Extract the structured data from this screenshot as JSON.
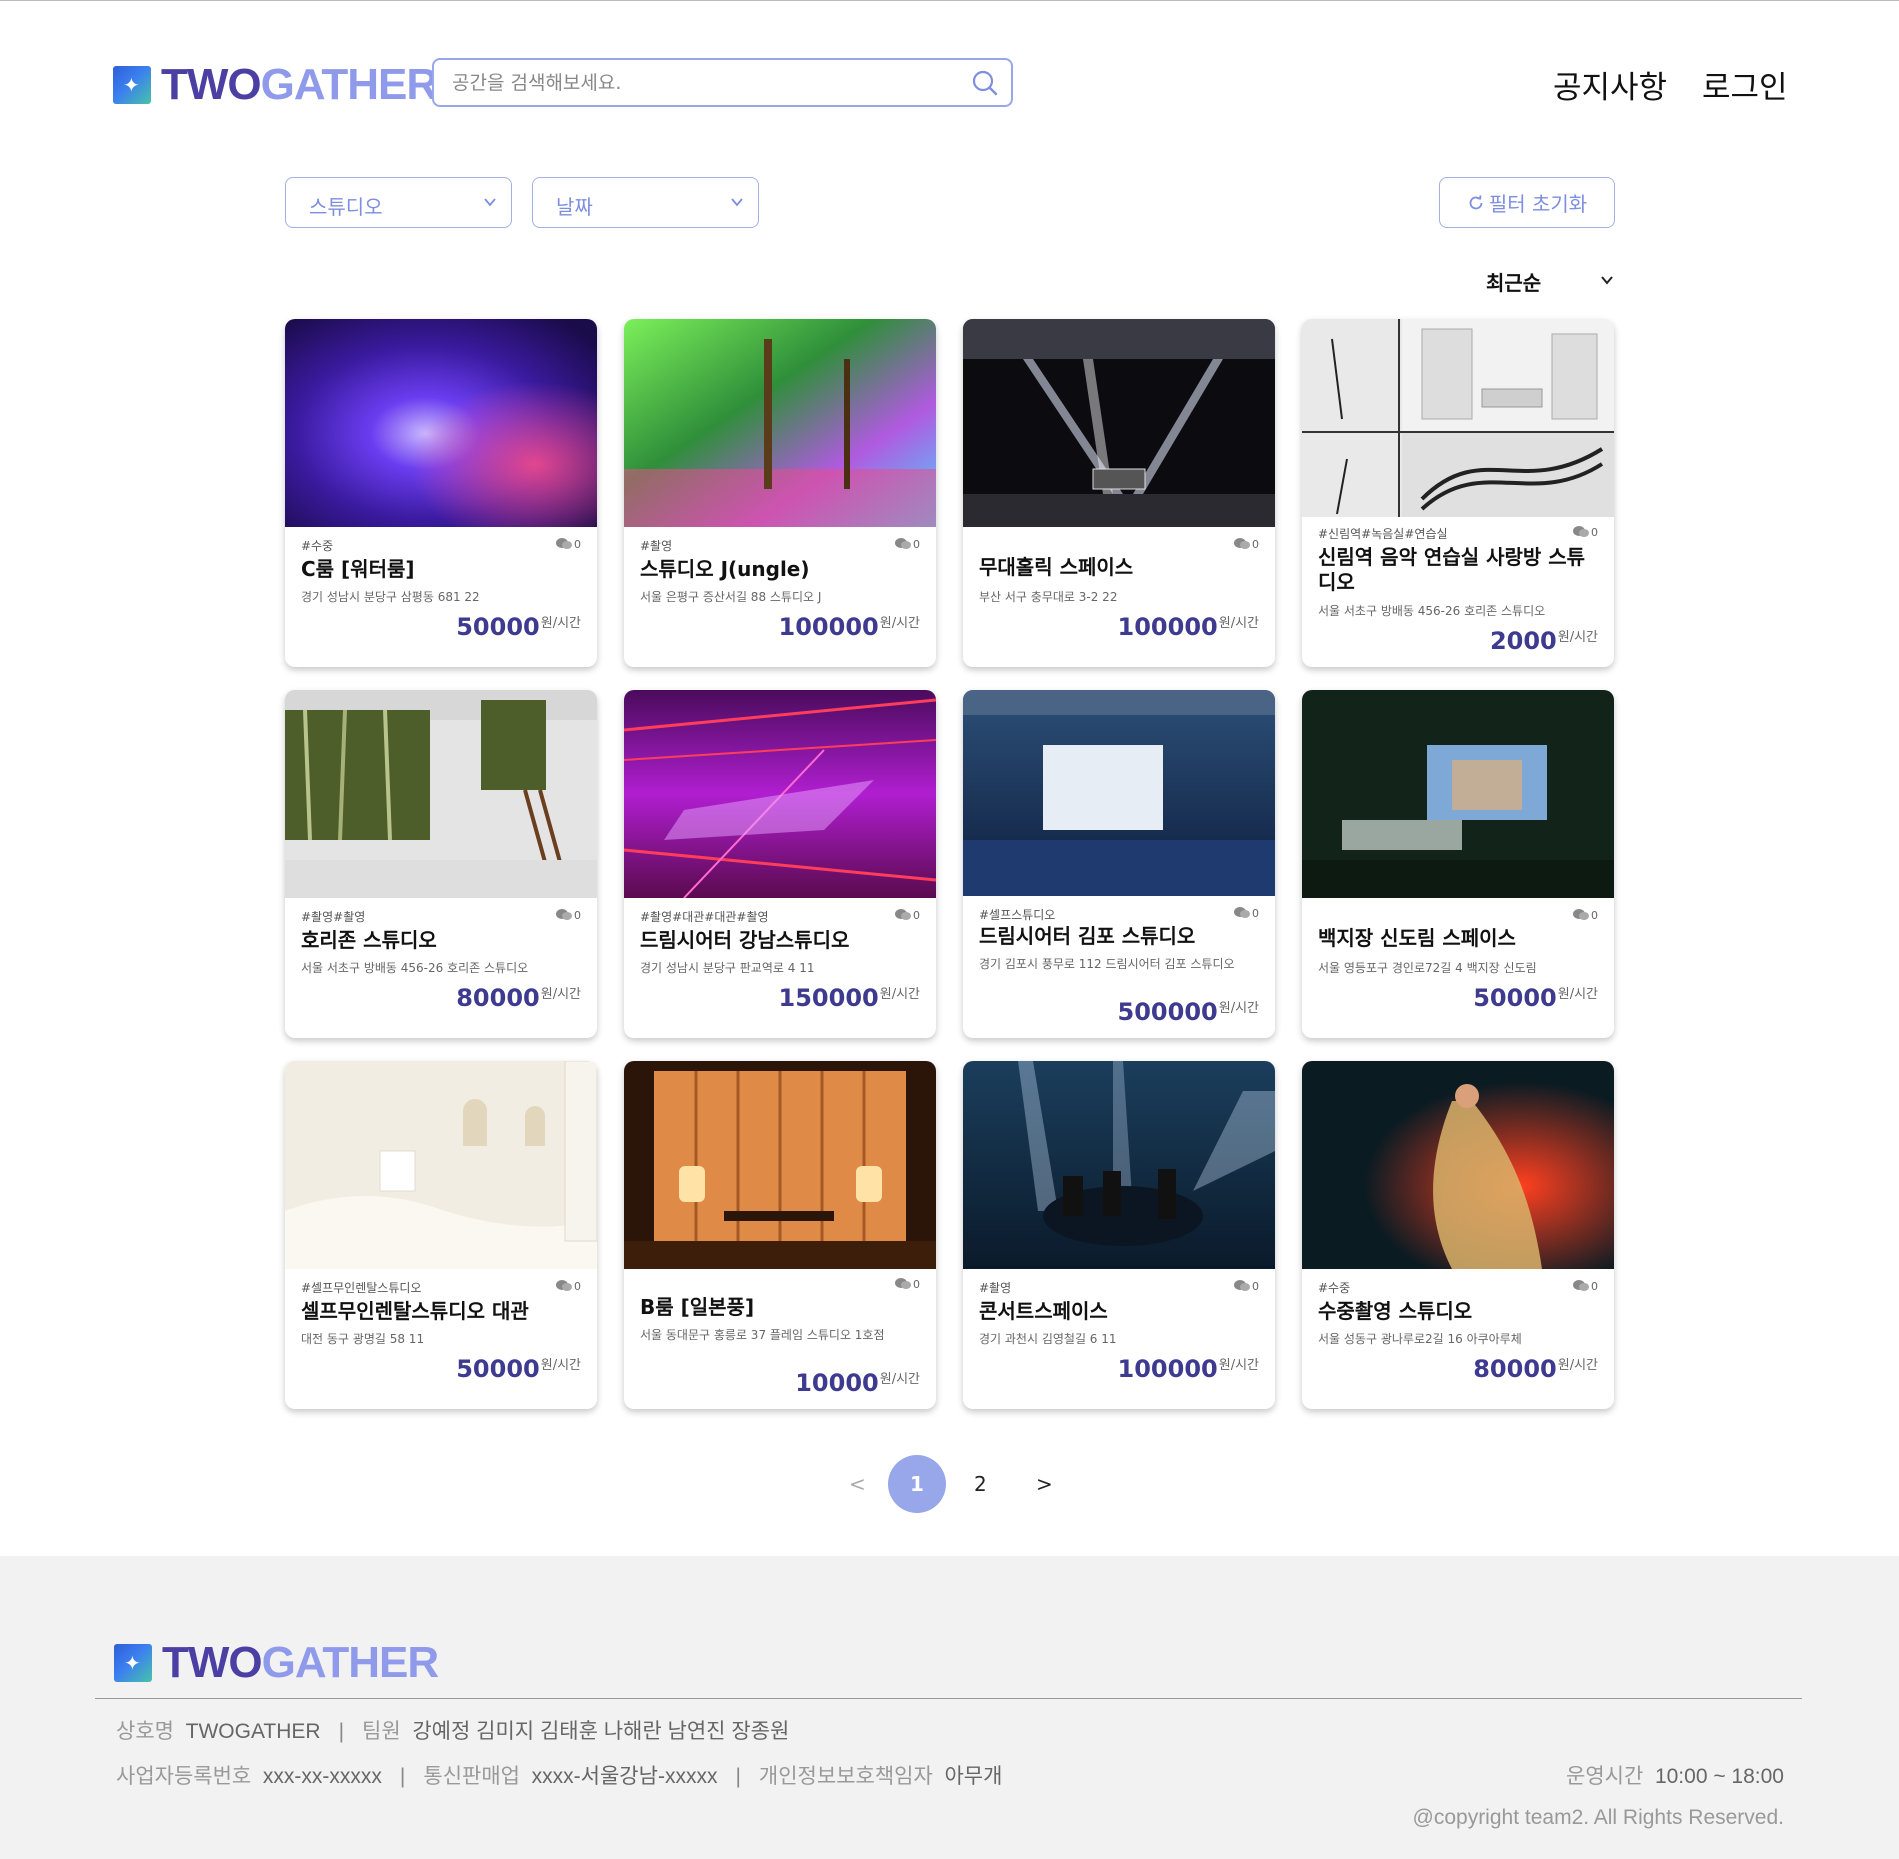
{
  "header": {
    "logo_two": "TWO",
    "logo_gather": "GATHER",
    "search_placeholder": "공간을 검색해보세요.",
    "nav_notice": "공지사항",
    "nav_login": "로그인"
  },
  "filters": {
    "category": "스튜디오",
    "date": "날짜",
    "reset": "필터 초기화",
    "sort": "최근순"
  },
  "cards": [
    {
      "tags": "#수중",
      "comments": "0",
      "title": "C룸 [워터룸]",
      "address": "경기 성남시 분당구 삼평동 681 22",
      "price": "50000",
      "unit": "원/시간"
    },
    {
      "tags": "#촬영",
      "comments": "0",
      "title": "스튜디오 J(ungle)",
      "address": "서울 은평구 증산서길 88 스튜디오 J",
      "price": "100000",
      "unit": "원/시간"
    },
    {
      "tags": "",
      "comments": "0",
      "title": "무대홀릭 스페이스",
      "address": "부산 서구 충무대로 3-2 22",
      "price": "100000",
      "unit": "원/시간"
    },
    {
      "tags": "#신림역#녹음실#연습실",
      "comments": "0",
      "title": "신림역 음악 연습실 사랑방 스튜디오",
      "address": "서울 서초구 방배동 456-26 호리존 스튜디오",
      "price": "2000",
      "unit": "원/시간"
    },
    {
      "tags": "#촬영#촬영",
      "comments": "0",
      "title": "호리존 스튜디오",
      "address": "서울 서초구 방배동 456-26 호리존 스튜디오",
      "price": "80000",
      "unit": "원/시간"
    },
    {
      "tags": "#촬영#대관#대관#촬영",
      "comments": "0",
      "title": "드림시어터 강남스튜디오",
      "address": "경기 성남시 분당구 판교역로 4 11",
      "price": "150000",
      "unit": "원/시간"
    },
    {
      "tags": "#셀프스튜디오",
      "comments": "0",
      "title": "드림시어터 김포 스튜디오",
      "address": "경기 김포시 풍무로 112 드림시어터 김포 스튜디오",
      "price": "500000",
      "unit": "원/시간"
    },
    {
      "tags": "",
      "comments": "0",
      "title": "백지장 신도림 스페이스",
      "address": "서울 영등포구 경인로72길 4 백지장 신도림",
      "price": "50000",
      "unit": "원/시간"
    },
    {
      "tags": "#셀프무인렌탈스튜디오",
      "comments": "0",
      "title": "셀프무인렌탈스튜디오 대관",
      "address": "대전 동구 광명길 58 11",
      "price": "50000",
      "unit": "원/시간"
    },
    {
      "tags": "",
      "comments": "0",
      "title": "B룸 [일본풍]",
      "address": "서울 동대문구 홍릉로 37 플레임 스튜디오 1호점",
      "price": "10000",
      "unit": "원/시간"
    },
    {
      "tags": "#촬영",
      "comments": "0",
      "title": "콘서트스페이스",
      "address": "경기 과천시 김영철길 6 11",
      "price": "100000",
      "unit": "원/시간"
    },
    {
      "tags": "#수중",
      "comments": "0",
      "title": "수중촬영 스튜디오",
      "address": "서울 성동구 광나루로2길 16 아쿠아루체",
      "price": "80000",
      "unit": "원/시간"
    }
  ],
  "pagination": {
    "prev": "<",
    "pages": [
      "1",
      "2"
    ],
    "current": "1",
    "next": ">"
  },
  "footer": {
    "logo_two": "TWO",
    "logo_gather": "GATHER",
    "company_label": "상호명",
    "company_value": "TWOGATHER",
    "team_label": "팀원",
    "team_value": "강예정 김미지 김태훈 나해란 남연진 장종원",
    "biz_label": "사업자등록번호",
    "biz_value": "xxx-xx-xxxxx",
    "mail_label": "통신판매업",
    "mail_value": "xxxx-서울강남-xxxxx",
    "privacy_label": "개인정보보호책임자",
    "privacy_value": "아무개",
    "hours_label": "운영시간",
    "hours_value": "10:00 ~ 18:00",
    "copyright": "@copyright team2. All Rights Reserved."
  },
  "colors": {
    "brand_dark": "#4b3fa3",
    "brand_light": "#8f9bea",
    "accent_border": "#97a7e8",
    "price": "#3e3a8f",
    "footer_bg": "#f2f2f2"
  }
}
